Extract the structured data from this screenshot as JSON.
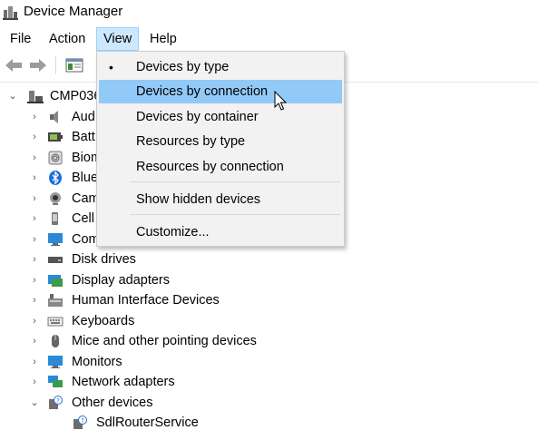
{
  "window": {
    "title": "Device Manager"
  },
  "menu": {
    "file": "File",
    "action": "Action",
    "view": "View",
    "help": "Help"
  },
  "view_menu": {
    "items": [
      {
        "label": "Devices by type",
        "checked": true
      },
      {
        "label": "Devices by connection",
        "highlighted": true
      },
      {
        "label": "Devices by container"
      },
      {
        "label": "Resources by type"
      },
      {
        "label": "Resources by connection"
      },
      {
        "label": "Show hidden devices"
      },
      {
        "label": "Customize..."
      }
    ]
  },
  "tree": {
    "root": "CMP036",
    "items": [
      {
        "label": "Aud",
        "icon": "speaker-icon"
      },
      {
        "label": "Batt",
        "icon": "battery-icon"
      },
      {
        "label": "Biom",
        "icon": "fingerprint-icon"
      },
      {
        "label": "Blue",
        "icon": "bluetooth-icon"
      },
      {
        "label": "Cam",
        "icon": "camera-icon"
      },
      {
        "label": "Cell",
        "icon": "cellular-icon"
      },
      {
        "label": "Com",
        "icon": "computer-icon"
      },
      {
        "label": "Disk drives",
        "icon": "disk-drive-icon"
      },
      {
        "label": "Display adapters",
        "icon": "display-adapter-icon"
      },
      {
        "label": "Human Interface Devices",
        "icon": "hid-icon"
      },
      {
        "label": "Keyboards",
        "icon": "keyboard-icon"
      },
      {
        "label": "Mice and other pointing devices",
        "icon": "mouse-icon"
      },
      {
        "label": "Monitors",
        "icon": "monitor-icon"
      },
      {
        "label": "Network adapters",
        "icon": "network-icon"
      },
      {
        "label": "Other devices",
        "icon": "unknown-device-icon",
        "expanded": true
      }
    ],
    "children": [
      {
        "label": "SdlRouterService",
        "icon": "unknown-device-icon"
      }
    ]
  },
  "colors": {
    "menu_active_bg": "#cce8ff",
    "dropdown_bg": "#f2f2f2",
    "dropdown_hover": "#91c9f7"
  }
}
